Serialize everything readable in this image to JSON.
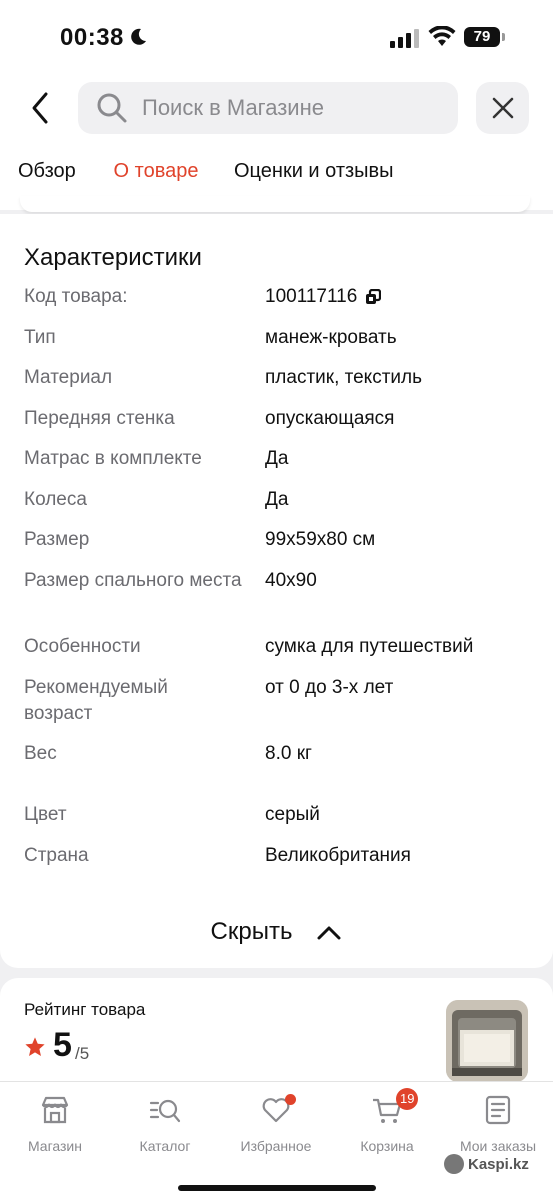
{
  "status_bar": {
    "time": "00:38",
    "battery": "79"
  },
  "header": {
    "search_placeholder": "Поиск в Магазине"
  },
  "tabs": [
    {
      "label": "Обзор"
    },
    {
      "label": "О товаре",
      "active": true
    },
    {
      "label": "Оценки и отзывы"
    }
  ],
  "characteristics": {
    "title": "Характеристики",
    "rows": [
      {
        "label": "Код товара:",
        "value": "100117116"
      },
      {
        "label": "Тип",
        "value": "манеж-кровать"
      },
      {
        "label": "Материал",
        "value": "пластик, текстиль"
      },
      {
        "label": "Передняя стенка",
        "value": "опускающаяся"
      },
      {
        "label": "Матрас в комплекте",
        "value": "Да"
      },
      {
        "label": "Колеса",
        "value": "Да"
      },
      {
        "label": "Размер",
        "value": "99x59x80 см"
      },
      {
        "label": "Размер спального места",
        "value": "40x90"
      },
      {
        "label": "Особенности",
        "value": "сумка для путешествий"
      },
      {
        "label": "Рекомендуемый возраст",
        "value": "от 0 до 3-х лет"
      },
      {
        "label": "Вес",
        "value": "8.0 кг"
      },
      {
        "label": "Цвет",
        "value": "серый"
      },
      {
        "label": "Страна",
        "value": "Великобритания"
      }
    ],
    "hide_label": "Скрыть"
  },
  "rating": {
    "title": "Рейтинг товара",
    "value": "5",
    "max": "/5"
  },
  "bottom_nav": {
    "items": [
      {
        "label": "Магазин",
        "icon": "shop-icon"
      },
      {
        "label": "Каталог",
        "icon": "catalog-icon"
      },
      {
        "label": "Избранное",
        "icon": "heart-icon"
      },
      {
        "label": "Корзина",
        "icon": "cart-icon",
        "badge": "19"
      },
      {
        "label": "Мои заказы",
        "icon": "orders-icon"
      }
    ]
  },
  "watermark": "Kaspi.kz",
  "colors": {
    "accent": "#e0432b",
    "muted": "#6b6b70",
    "background": "#f0f0f2"
  }
}
